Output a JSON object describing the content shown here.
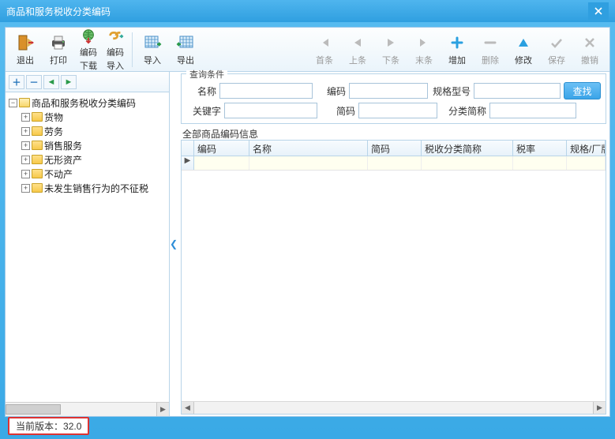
{
  "window": {
    "title": "商品和服务税收分类编码"
  },
  "toolbar_left": {
    "exit": "退出",
    "print": "打印",
    "code_download_l1": "编码",
    "code_download_l2": "下载",
    "code_import_l1": "编码",
    "code_import_l2": "导入",
    "import": "导入",
    "export": "导出"
  },
  "toolbar_right": {
    "first": "首条",
    "prev": "上条",
    "next": "下条",
    "last": "末条",
    "add": "增加",
    "delete": "删除",
    "edit": "修改",
    "save": "保存",
    "undo": "撤销"
  },
  "tree": {
    "root": "商品和服务税收分类编码",
    "children": [
      "货物",
      "劳务",
      "销售服务",
      "无形资产",
      "不动产",
      "未发生销售行为的不征税"
    ]
  },
  "query": {
    "group_title": "查询条件",
    "labels": {
      "name": "名称",
      "code": "编码",
      "spec": "规格型号",
      "keyword": "关键字",
      "short": "简码",
      "cat_short": "分类简称"
    },
    "values": {
      "name": "",
      "code": "",
      "spec": "",
      "keyword": "",
      "short": "",
      "cat_short": ""
    },
    "search_btn": "查找"
  },
  "grid": {
    "title": "全部商品编码信息",
    "columns": [
      "编码",
      "名称",
      "简码",
      "税收分类简称",
      "税率",
      "规格/厂牌"
    ],
    "widths": [
      70,
      150,
      68,
      116,
      68,
      60
    ]
  },
  "status": {
    "version_label": "当前版本：",
    "version": "32.0"
  }
}
